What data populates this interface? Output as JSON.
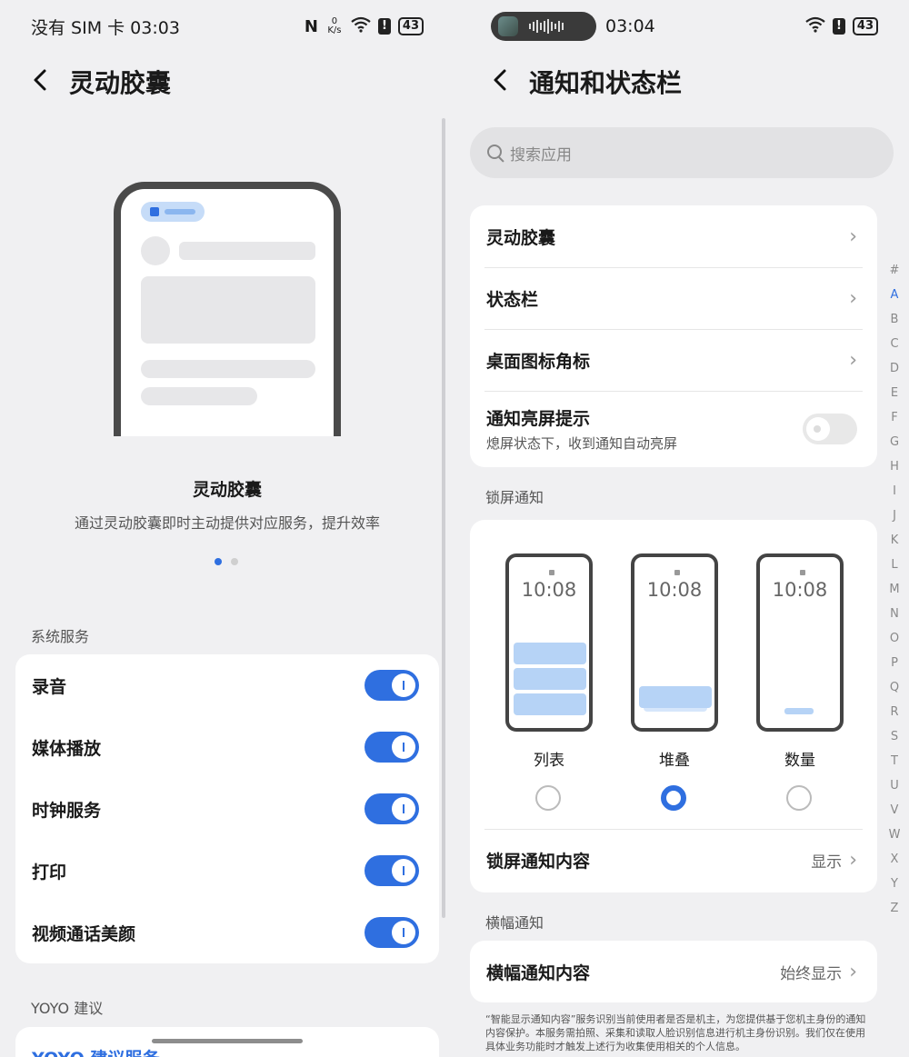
{
  "left": {
    "status": {
      "carrier_time": "没有 SIM 卡 03:03",
      "speed": "0 K/s",
      "battery": "43"
    },
    "header": {
      "back_glyph": "‹",
      "title": "灵动胶囊"
    },
    "intro": {
      "title": "灵动胶囊",
      "subtitle": "通过灵动胶囊即时主动提供对应服务，提升效率",
      "page": 1,
      "pages": 2
    },
    "system_section": {
      "label": "系统服务",
      "items": [
        {
          "label": "录音",
          "on": true
        },
        {
          "label": "媒体播放",
          "on": true
        },
        {
          "label": "时钟服务",
          "on": true
        },
        {
          "label": "打印",
          "on": true
        },
        {
          "label": "视频通话美颜",
          "on": true
        }
      ]
    },
    "yoyo_section": {
      "label": "YOYO 建议",
      "item": "YOYO 建议服务"
    }
  },
  "right": {
    "status": {
      "time": "03:04",
      "battery": "43"
    },
    "header": {
      "back_glyph": "‹",
      "title": "通知和状态栏"
    },
    "search": {
      "placeholder": "搜索应用"
    },
    "main_items": [
      {
        "label": "灵动胶囊"
      },
      {
        "label": "状态栏"
      },
      {
        "label": "桌面图标角标"
      }
    ],
    "wake_item": {
      "label": "通知亮屏提示",
      "sub": "熄屏状态下，收到通知自动亮屏",
      "on": false
    },
    "lock_section": {
      "label": "锁屏通知",
      "clock": "10:08",
      "modes": [
        {
          "label": "列表",
          "selected": false
        },
        {
          "label": "堆叠",
          "selected": true
        },
        {
          "label": "数量",
          "selected": false
        }
      ],
      "content_item": {
        "label": "锁屏通知内容",
        "value": "显示"
      }
    },
    "banner_section": {
      "label": "横幅通知",
      "item": {
        "label": "横幅通知内容",
        "value": "始终显示"
      }
    },
    "footnote": "“智能显示通知内容”服务识别当前使用者是否是机主，为您提供基于您机主身份的通知内容保护。本服务需拍照、采集和读取人脸识别信息进行机主身份识别。我们仅在使用具体业务功能时才触发上述行为收集使用相关的个人信息。",
    "alphabet": [
      "#",
      "A",
      "B",
      "C",
      "D",
      "E",
      "F",
      "G",
      "H",
      "I",
      "J",
      "K",
      "L",
      "M",
      "N",
      "O",
      "P",
      "Q",
      "R",
      "S",
      "T",
      "U",
      "V",
      "W",
      "X",
      "Y",
      "Z"
    ],
    "alphabet_active": "A"
  },
  "icons": {
    "back": "chevron-left-icon",
    "chevron": "chevron-right-icon",
    "search": "search-icon",
    "nfc": "nfc-icon",
    "wifi": "wifi-icon",
    "alert": "alert-icon",
    "battery": "battery-icon"
  },
  "colors": {
    "accent": "#2f6fe0",
    "background": "#f0f0f2",
    "card": "#ffffff"
  }
}
